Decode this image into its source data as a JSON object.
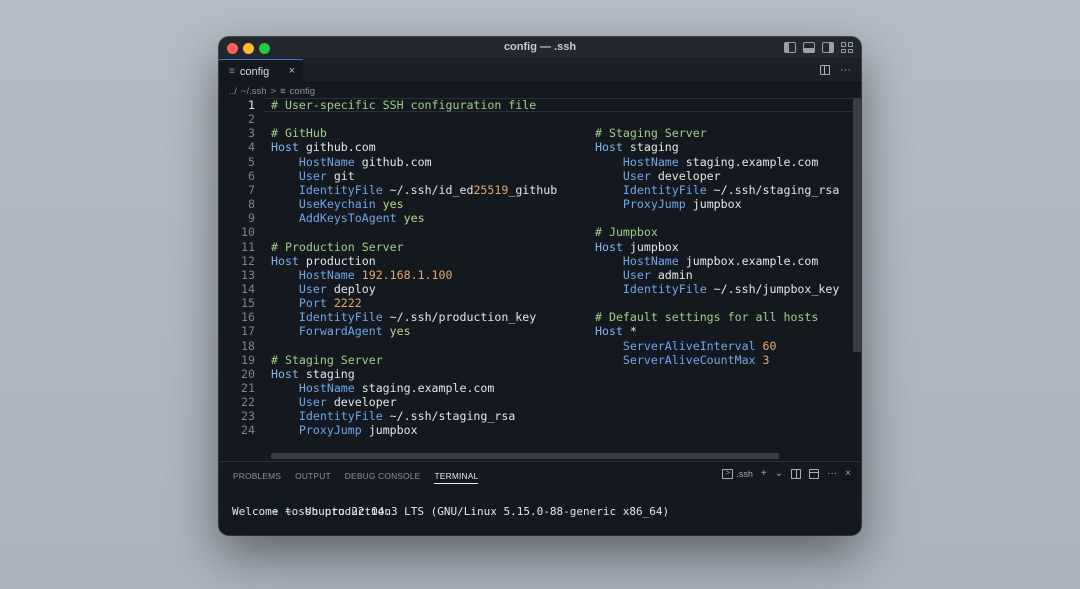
{
  "window": {
    "title": "config — .ssh"
  },
  "tab": {
    "label": "config",
    "close": "×"
  },
  "breadcrumb": {
    "path": "~/.ssh",
    "prefix": "../",
    "sep": ">",
    "file": "config"
  },
  "editor": {
    "active_line": 1,
    "lines_left": [
      [
        [
          "c-comment",
          "# User-specific SSH configuration file"
        ]
      ],
      [],
      [
        [
          "c-comment",
          "# GitHub"
        ]
      ],
      [
        [
          "c-kw",
          "Host"
        ],
        [
          "c-plain",
          " github.com"
        ]
      ],
      [
        [
          "c-plain",
          "    "
        ],
        [
          "c-prop",
          "HostName"
        ],
        [
          "c-plain",
          " github.com"
        ]
      ],
      [
        [
          "c-plain",
          "    "
        ],
        [
          "c-prop",
          "User"
        ],
        [
          "c-plain",
          " git"
        ]
      ],
      [
        [
          "c-plain",
          "    "
        ],
        [
          "c-prop",
          "IdentityFile"
        ],
        [
          "c-plain",
          " ~/.ssh/id_ed"
        ],
        [
          "c-num",
          "25519"
        ],
        [
          "c-plain",
          "_github"
        ]
      ],
      [
        [
          "c-plain",
          "    "
        ],
        [
          "c-prop",
          "UseKeychain"
        ],
        [
          "c-yes",
          " yes"
        ]
      ],
      [
        [
          "c-plain",
          "    "
        ],
        [
          "c-prop",
          "AddKeysToAgent"
        ],
        [
          "c-yes",
          " yes"
        ]
      ],
      [],
      [
        [
          "c-comment",
          "# Production Server"
        ]
      ],
      [
        [
          "c-kw",
          "Host"
        ],
        [
          "c-plain",
          " production"
        ]
      ],
      [
        [
          "c-plain",
          "    "
        ],
        [
          "c-prop",
          "HostName"
        ],
        [
          "c-num",
          " 192.168.1.100"
        ]
      ],
      [
        [
          "c-plain",
          "    "
        ],
        [
          "c-prop",
          "User"
        ],
        [
          "c-plain",
          " deploy"
        ]
      ],
      [
        [
          "c-plain",
          "    "
        ],
        [
          "c-prop",
          "Port"
        ],
        [
          "c-num",
          " 2222"
        ]
      ],
      [
        [
          "c-plain",
          "    "
        ],
        [
          "c-prop",
          "IdentityFile"
        ],
        [
          "c-plain",
          " ~/.ssh/production_key"
        ]
      ],
      [
        [
          "c-plain",
          "    "
        ],
        [
          "c-prop",
          "ForwardAgent"
        ],
        [
          "c-yes",
          " yes"
        ]
      ],
      [],
      [
        [
          "c-comment",
          "# Staging Server"
        ]
      ],
      [
        [
          "c-kw",
          "Host"
        ],
        [
          "c-plain",
          " staging"
        ]
      ],
      [
        [
          "c-plain",
          "    "
        ],
        [
          "c-prop",
          "HostName"
        ],
        [
          "c-plain",
          " staging.example.com"
        ]
      ],
      [
        [
          "c-plain",
          "    "
        ],
        [
          "c-prop",
          "User"
        ],
        [
          "c-plain",
          " developer"
        ]
      ],
      [
        [
          "c-plain",
          "    "
        ],
        [
          "c-prop",
          "IdentityFile"
        ],
        [
          "c-plain",
          " ~/.ssh/staging_rsa"
        ]
      ],
      [
        [
          "c-plain",
          "    "
        ],
        [
          "c-prop",
          "ProxyJump"
        ],
        [
          "c-plain",
          " jumpbox"
        ]
      ]
    ],
    "lines_right": [
      [],
      [],
      [
        [
          "c-comment",
          "# Staging Server"
        ]
      ],
      [
        [
          "c-kw",
          "Host"
        ],
        [
          "c-plain",
          " staging"
        ]
      ],
      [
        [
          "c-plain",
          "    "
        ],
        [
          "c-prop",
          "HostName"
        ],
        [
          "c-plain",
          " staging.example.com"
        ]
      ],
      [
        [
          "c-plain",
          "    "
        ],
        [
          "c-prop",
          "User"
        ],
        [
          "c-plain",
          " developer"
        ]
      ],
      [
        [
          "c-plain",
          "    "
        ],
        [
          "c-prop",
          "IdentityFile"
        ],
        [
          "c-plain",
          " ~/.ssh/staging_rsa"
        ]
      ],
      [
        [
          "c-plain",
          "    "
        ],
        [
          "c-prop",
          "ProxyJump"
        ],
        [
          "c-plain",
          " jumpbox"
        ]
      ],
      [],
      [
        [
          "c-comment",
          "# Jumpbox"
        ]
      ],
      [
        [
          "c-kw",
          "Host"
        ],
        [
          "c-plain",
          " jumpbox"
        ]
      ],
      [
        [
          "c-plain",
          "    "
        ],
        [
          "c-prop",
          "HostName"
        ],
        [
          "c-plain",
          " jumpbox.example.com"
        ]
      ],
      [
        [
          "c-plain",
          "    "
        ],
        [
          "c-prop",
          "User"
        ],
        [
          "c-plain",
          " admin"
        ]
      ],
      [
        [
          "c-plain",
          "    "
        ],
        [
          "c-prop",
          "IdentityFile"
        ],
        [
          "c-plain",
          " ~/.ssh/jumpbox_key"
        ]
      ],
      [],
      [
        [
          "c-comment",
          "# Default settings for all hosts"
        ]
      ],
      [
        [
          "c-kw",
          "Host"
        ],
        [
          "c-plain",
          " *"
        ]
      ],
      [
        [
          "c-plain",
          "    "
        ],
        [
          "c-prop",
          "ServerAliveInterval"
        ],
        [
          "c-num",
          " 60"
        ]
      ],
      [
        [
          "c-plain",
          "    "
        ],
        [
          "c-prop",
          "ServerAliveCountMax"
        ],
        [
          "c-num",
          " 3"
        ]
      ]
    ]
  },
  "panel": {
    "tabs": [
      "PROBLEMS",
      "OUTPUT",
      "DEBUG CONSOLE",
      "TERMINAL"
    ],
    "active_tab": "TERMINAL",
    "shell_label": ".ssh",
    "plus": "+",
    "chevron": "⌄",
    "trash": "🗑",
    "more": "···",
    "close": "×"
  },
  "terminal": {
    "prompt_symbol": "➜",
    "prompt_dir": "~",
    "command": "ssh production",
    "output": "Welcome to Ubuntu 22.04.3 LTS (GNU/Linux 5.15.0-88-generic x86_64)"
  },
  "icons": {
    "file": "≡",
    "split": "split-editor-icon",
    "more": "···"
  }
}
